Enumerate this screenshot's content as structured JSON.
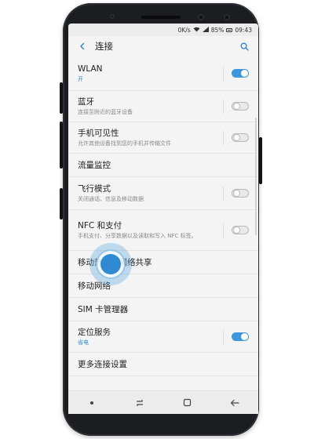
{
  "statusbar": {
    "speed": "0K/s",
    "battery": "85%",
    "time": "09:43"
  },
  "appbar": {
    "title": "连接",
    "back_icon": "back-arrow-icon",
    "search_icon": "search-icon"
  },
  "settings": [
    {
      "key": "wlan",
      "label": "WLAN",
      "sub": "开",
      "toggle": true
    },
    {
      "key": "bluetooth",
      "label": "蓝牙",
      "sub": "连接至附近的蓝牙设备",
      "toggle": false
    },
    {
      "key": "visibility",
      "label": "手机可见性",
      "sub": "允许其他设备找到您的手机并传输文件",
      "toggle": false
    },
    {
      "key": "data_usage",
      "label": "流量监控",
      "sub": ""
    },
    {
      "key": "airplane",
      "label": "飞行模式",
      "sub": "关闭通话、信息及移动数据",
      "toggle": false
    },
    {
      "key": "nfc",
      "label": "NFC 和支付",
      "sub": "手机支付、分享数据以及读取和写入 NFC 标签。",
      "toggle": false
    },
    {
      "key": "hotspot",
      "label": "移动热点和网络共享",
      "sub": ""
    },
    {
      "key": "mobile_net",
      "label": "移动网络",
      "sub": ""
    },
    {
      "key": "sim",
      "label": "SIM 卡管理器",
      "sub": ""
    },
    {
      "key": "location",
      "label": "定位服务",
      "sub": "省电",
      "toggle": true
    },
    {
      "key": "more",
      "label": "更多连接设置",
      "sub": ""
    }
  ],
  "navbar": {
    "icons": [
      "dot-icon",
      "recents-icon",
      "home-icon",
      "back-icon"
    ]
  },
  "colors": {
    "accent": "#2b8bd6",
    "toggle_on": "#3b97dc"
  }
}
